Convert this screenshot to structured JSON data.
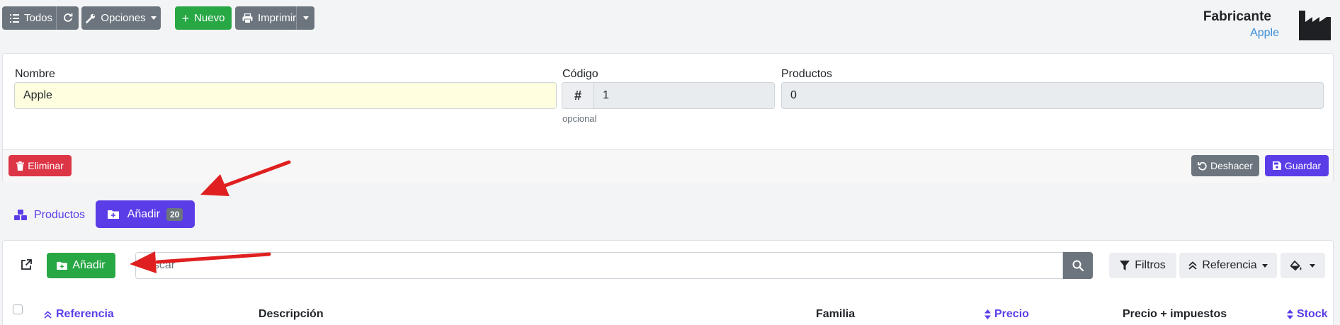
{
  "toolbar": {
    "all_label": "Todos",
    "options_label": "Opciones",
    "new_label": "Nuevo",
    "print_label": "Imprimir"
  },
  "header": {
    "title": "Fabricante",
    "subtitle": "Apple"
  },
  "form": {
    "name_label": "Nombre",
    "name_value": "Apple",
    "code_label": "Código",
    "code_prefix": "#",
    "code_value": "1",
    "code_help": "opcional",
    "products_label": "Productos",
    "products_value": "0",
    "delete_label": "Eliminar",
    "undo_label": "Deshacer",
    "save_label": "Guardar"
  },
  "tabs": {
    "products_label": "Productos",
    "add_label": "Añadir",
    "add_count": "20"
  },
  "list": {
    "add_label": "Añadir",
    "search_placeholder": "uscar",
    "filters_label": "Filtros",
    "sort_label": "Referencia",
    "columns": [
      "Referencia",
      "Descripción",
      "Familia",
      "Precio",
      "Precio + impuestos",
      "Stock"
    ]
  },
  "colors": {
    "primary": "#5b3de8",
    "success": "#28a745",
    "danger": "#dc3545",
    "secondary": "#6c757d",
    "annotation_arrow": "#e02020"
  }
}
